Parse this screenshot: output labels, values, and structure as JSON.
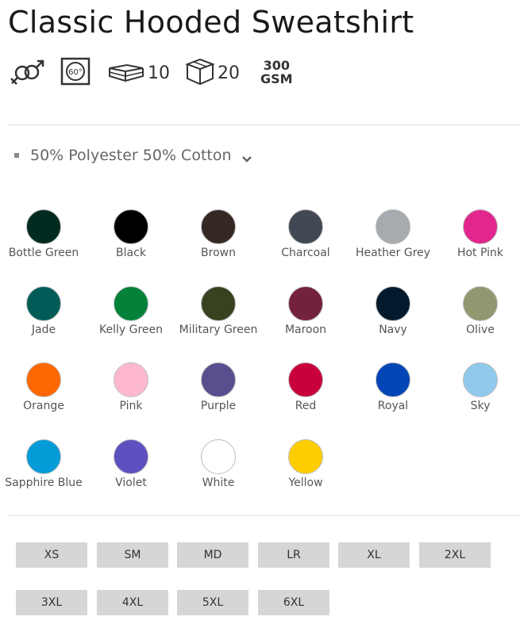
{
  "product": {
    "title": "Classic Hooded Sweatshirt"
  },
  "features": {
    "gender_icon": "unisex-icon",
    "wash_icon": "wash-60-icon",
    "wash_temp": "60°",
    "pack_icon": "pack-icon",
    "pack_qty": "10",
    "carton_icon": "carton-box-icon",
    "carton_qty": "20",
    "weight_value": "300",
    "weight_unit": "GSM"
  },
  "fabric": {
    "label": "50% Polyester 50% Cotton",
    "dropdown_icon": "chevron-down-icon"
  },
  "colours": [
    {
      "name": "Bottle Green",
      "hex": "#012a20"
    },
    {
      "name": "Black",
      "hex": "#000000"
    },
    {
      "name": "Brown",
      "hex": "#352824"
    },
    {
      "name": "Charcoal",
      "hex": "#414853"
    },
    {
      "name": "Heather Grey",
      "hex": "#a7aaae"
    },
    {
      "name": "Hot Pink",
      "hex": "#e3268e"
    },
    {
      "name": "Jade",
      "hex": "#015c57"
    },
    {
      "name": "Kelly Green",
      "hex": "#04823a"
    },
    {
      "name": "Military Green",
      "hex": "#374220"
    },
    {
      "name": "Maroon",
      "hex": "#74213e"
    },
    {
      "name": "Navy",
      "hex": "#031a2c"
    },
    {
      "name": "Olive",
      "hex": "#8f9870"
    },
    {
      "name": "Orange",
      "hex": "#fc6700"
    },
    {
      "name": "Pink",
      "hex": "#fdb8cf"
    },
    {
      "name": "Purple",
      "hex": "#5a4e8e"
    },
    {
      "name": "Red",
      "hex": "#c8003c"
    },
    {
      "name": "Royal",
      "hex": "#0245b5"
    },
    {
      "name": "Sky",
      "hex": "#90c9ec"
    },
    {
      "name": "Sapphire Blue",
      "hex": "#049bd6"
    },
    {
      "name": "Violet",
      "hex": "#5d50bf"
    },
    {
      "name": "White",
      "hex": "#ffffff"
    },
    {
      "name": "Yellow",
      "hex": "#fecd00"
    }
  ],
  "sizes": [
    "XS",
    "SM",
    "MD",
    "LR",
    "XL",
    "2XL",
    "3XL",
    "4XL",
    "5XL",
    "6XL"
  ]
}
